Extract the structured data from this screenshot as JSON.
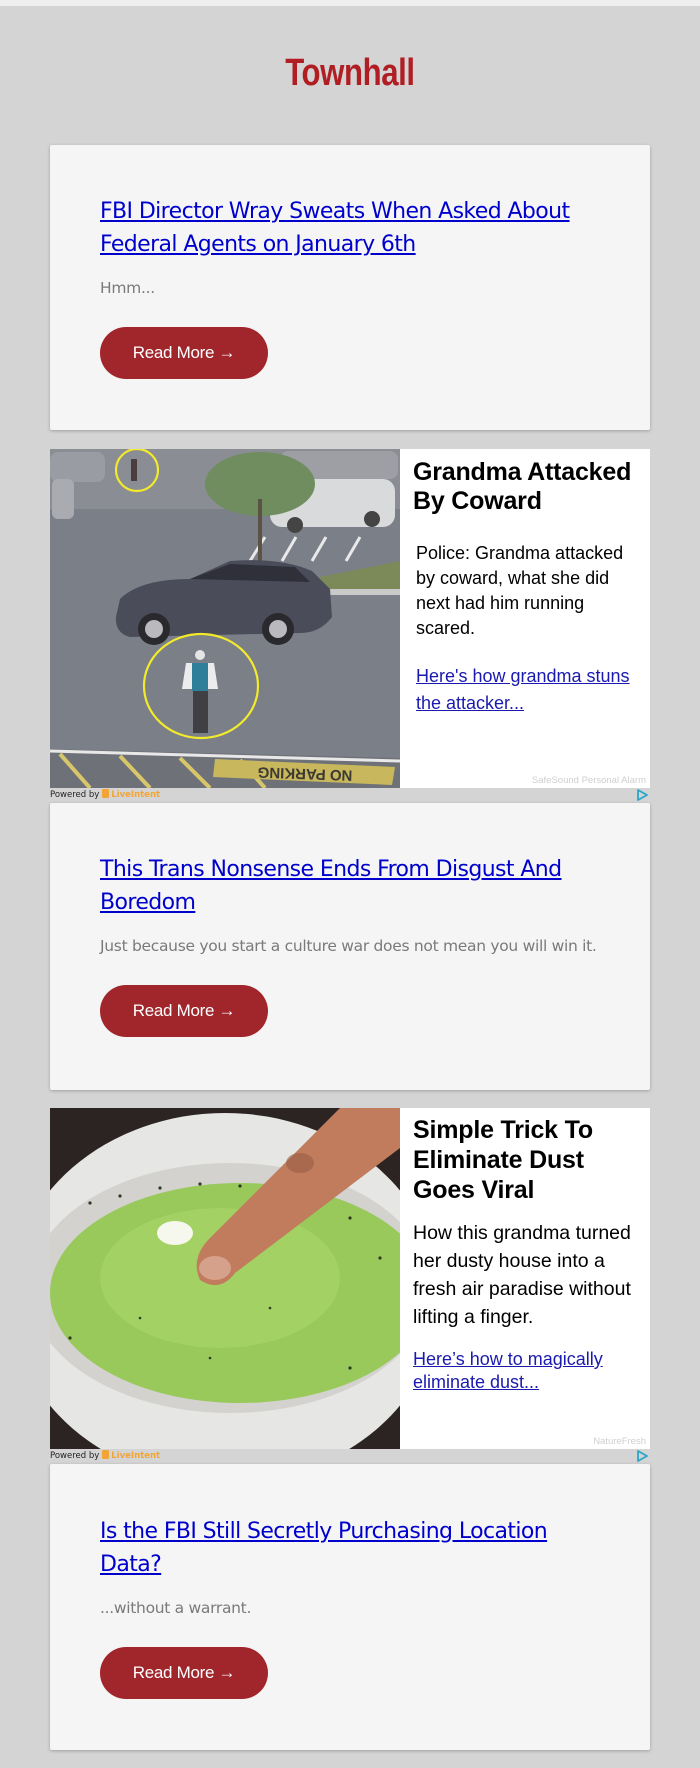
{
  "site": {
    "name": "Townhall",
    "brand_color": "#b01e24",
    "button_color": "#a0262b",
    "link_color": "#0000cc"
  },
  "articles": [
    {
      "title": "FBI Director Wray Sweats When Asked About Federal Agents on January 6th",
      "dek": "Hmm...",
      "button_label": "Read More →"
    },
    {
      "title": "This Trans Nonsense Ends From Disgust And Boredom",
      "dek": "Just because you start a culture war does not mean you will win it.",
      "button_label": "Read More →"
    },
    {
      "title": "Is the FBI Still Secretly Purchasing Location Data?",
      "dek": "...without a warrant.",
      "button_label": "Read More →"
    }
  ],
  "ads": [
    {
      "image_description": "parking-lot surveillance photo with yellow circles around two people",
      "image_text": "NO PARKING",
      "headline": "Grandma Attacked By Coward",
      "body": "Police: Grandma attacked by coward, what she did next had him running scared.",
      "link_text": "Here's how grandma stuns the attacker...",
      "sponsor": "SafeSound Personal Alarm",
      "powered_by_label": "Powered by",
      "powered_by_brand": "LiveIntent"
    },
    {
      "image_description": "finger dipped into a bowl of green liquid",
      "headline": "Simple Trick To Eliminate Dust Goes Viral",
      "body": "How this grandma turned her dusty house into a fresh air paradise without lifting a finger.",
      "link_text": "Here’s how to magically eliminate dust...",
      "sponsor": "NatureFresh",
      "powered_by_label": "Powered by",
      "powered_by_brand": "LiveIntent"
    }
  ]
}
